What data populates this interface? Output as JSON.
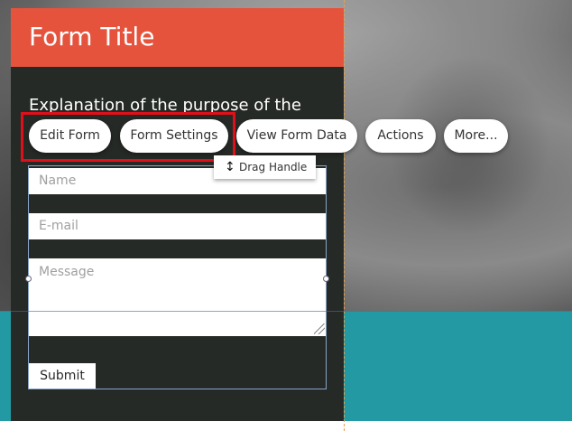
{
  "form": {
    "title": "Form Title",
    "description": "Explanation of the purpose of the",
    "fields": {
      "name_placeholder": "Name",
      "email_placeholder": "E-mail",
      "message_placeholder": "Message"
    },
    "submit_label": "Submit"
  },
  "toolbar": {
    "edit_form": "Edit Form",
    "form_settings": "Form Settings",
    "view_form_data": "View Form Data",
    "actions": "Actions",
    "more": "More..."
  },
  "drag_handle": {
    "icon": "vertical-arrows-icon",
    "label": "Drag Handle"
  },
  "colors": {
    "header": "#e5533d",
    "panel": "#262a26",
    "teal": "#2399a3",
    "highlight": "#e0101a"
  }
}
